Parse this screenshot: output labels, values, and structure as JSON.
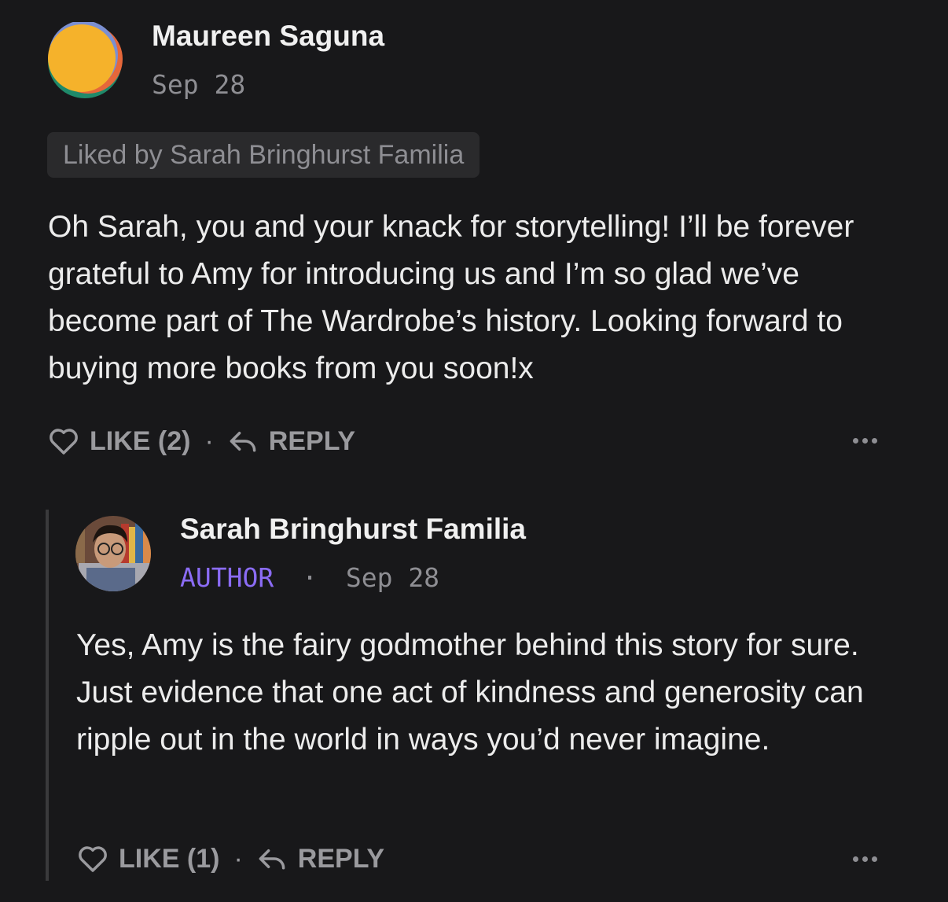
{
  "comments": [
    {
      "author": "Maureen Saguna",
      "date": "Sep 28",
      "liked_by": "Liked by Sarah Bringhurst Familia",
      "text": "Oh Sarah, you and your knack for storytelling! I’ll be forever grateful to Amy for introducing us and I’m so glad we’ve become part of The Wardrobe’s history. Looking forward to buying more books from you soon!x",
      "like_label": "LIKE (2)",
      "reply_label": "REPLY"
    },
    {
      "author": "Sarah Bringhurst Familia",
      "badge": "AUTHOR",
      "date": "Sep 28",
      "text": "Yes, Amy is the fairy godmother behind this story for sure. Just evidence that one act of kindness and generosity can ripple out in the world in ways you’d never imagine.",
      "like_label": "LIKE (1)",
      "reply_label": "REPLY"
    }
  ],
  "separator": "·",
  "colors": {
    "background": "#18181a",
    "author_badge": "#8b6cf5",
    "muted": "#8e8e93"
  },
  "icons": {
    "like": "heart-outline-icon",
    "reply": "reply-arrow-icon",
    "more": "more-dots-icon"
  }
}
